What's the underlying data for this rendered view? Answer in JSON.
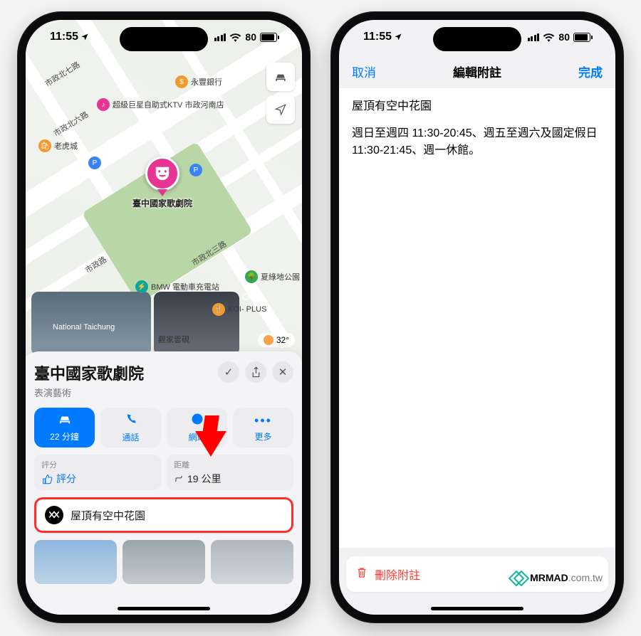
{
  "status": {
    "time": "11:55",
    "battery_pct": "80"
  },
  "map": {
    "controls": {
      "mode_icon": "car-icon",
      "locate_icon": "location-arrow-icon"
    },
    "main_pin_label": "臺中國家歌劇院",
    "labels": {
      "road_a": "市政北七路",
      "road_b": "市政北六路",
      "road_c": "市政路",
      "road_d": "市政北三路"
    },
    "pois": [
      {
        "name": "永豐銀行",
        "color": "orange"
      },
      {
        "name": "超級巨星自助式KTV 市政河南店",
        "color": "pink"
      },
      {
        "name": "老虎城",
        "color": "orange"
      },
      {
        "name": "BMW 電動車充電站",
        "color": "aqua"
      },
      {
        "name": "夏綠地公園",
        "color": "green"
      },
      {
        "name": "KOI- PLUS",
        "color": "orange"
      },
      {
        "name": "觀家雲硯",
        "color": ""
      },
      {
        "name": "National Taichung",
        "color": ""
      }
    ],
    "parking_icon": "P",
    "temperature": "32°",
    "photo_overlay_icon": "binoculars-icon"
  },
  "sheet": {
    "title": "臺中國家歌劇院",
    "subtitle": "表演藝術",
    "head_icons": {
      "check": "✓",
      "share": "⇪",
      "close": "✕"
    },
    "actions": {
      "drive_label": "22 分鐘",
      "call_label": "通話",
      "website_label": "網站",
      "more_label": "更多"
    },
    "metrics": {
      "rating_header": "評分",
      "rating_value": "評分",
      "distance_header": "距離",
      "distance_value": "19 公里"
    },
    "note_text": "屋頂有空中花園"
  },
  "editor": {
    "cancel": "取消",
    "title": "編輯附註",
    "done": "完成",
    "line1": "屋頂有空中花園",
    "line2": "週日至週四 11:30-20:45、週五至週六及國定假日 11:30-21:45、週一休館。",
    "delete_label": "刪除附註"
  },
  "watermark": {
    "brand": "MRMAD",
    "domain": ".com.tw"
  }
}
